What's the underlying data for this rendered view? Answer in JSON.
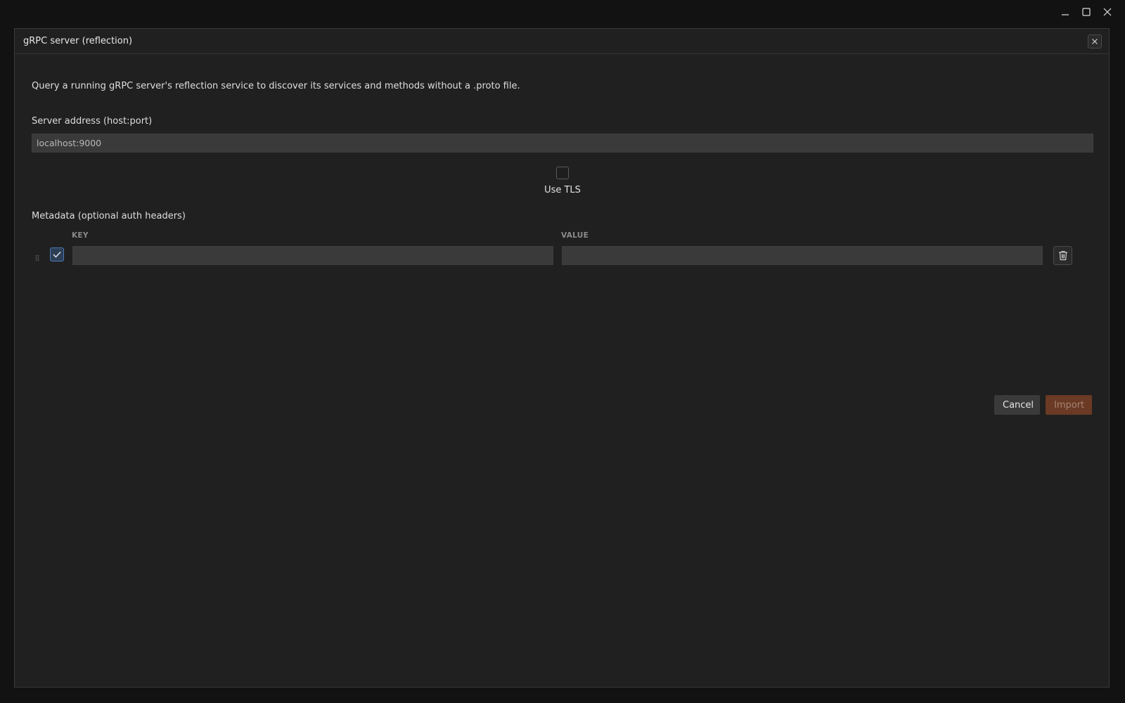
{
  "dialog": {
    "title": "gRPC server (reflection)",
    "description": "Query a running gRPC server's reflection service to discover its services and methods without a .proto file.",
    "close_icon": "close-icon"
  },
  "address": {
    "label": "Server address (host:port)",
    "value": "localhost:9000"
  },
  "tls": {
    "label": "Use TLS",
    "checked": false
  },
  "metadata": {
    "label": "Metadata (optional auth headers)",
    "columns": {
      "key": "KEY",
      "value": "VALUE"
    },
    "rows": [
      {
        "enabled": true,
        "key": "",
        "value": ""
      }
    ]
  },
  "actions": {
    "cancel_label": "Cancel",
    "import_label": "Import"
  },
  "colors": {
    "background": "#202020",
    "input_bg": "#3a3a3a",
    "import_accent": "#6a3a24",
    "checkbox_accent": "#4a7ab8"
  },
  "icons": {
    "minimize": "minimize-icon",
    "maximize": "maximize-icon",
    "window_close": "window-close-icon",
    "drag": "drag-handle-icon",
    "check": "checkmark-icon",
    "delete": "trash-icon"
  }
}
